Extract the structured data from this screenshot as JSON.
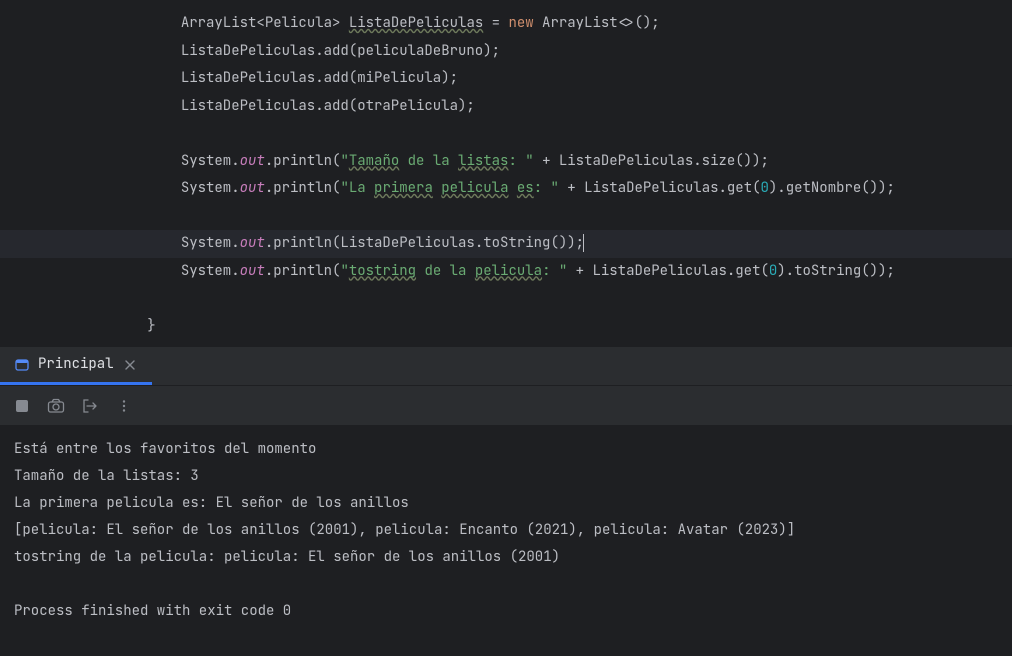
{
  "code": {
    "lines": [
      {
        "indent": 3,
        "segments": [
          {
            "text": "ArrayList",
            "cls": "type"
          },
          {
            "text": "<",
            "cls": ""
          },
          {
            "text": "Pelicula",
            "cls": "type"
          },
          {
            "text": "> ",
            "cls": ""
          },
          {
            "text": "ListaDePeliculas",
            "cls": "warn"
          },
          {
            "text": " = ",
            "cls": ""
          },
          {
            "text": "new",
            "cls": "kw"
          },
          {
            "text": " ArrayList<>();",
            "cls": ""
          }
        ]
      },
      {
        "indent": 3,
        "segments": [
          {
            "text": "ListaDePeliculas.add(peliculaDeBruno);",
            "cls": ""
          }
        ]
      },
      {
        "indent": 3,
        "segments": [
          {
            "text": "ListaDePeliculas.add(miPelicula);",
            "cls": ""
          }
        ]
      },
      {
        "indent": 3,
        "segments": [
          {
            "text": "ListaDePeliculas.add(otraPelicula);",
            "cls": ""
          }
        ]
      },
      {
        "indent": 0,
        "segments": []
      },
      {
        "indent": 3,
        "segments": [
          {
            "text": "System.",
            "cls": ""
          },
          {
            "text": "out",
            "cls": "static-field"
          },
          {
            "text": ".println(",
            "cls": ""
          },
          {
            "text": "\"",
            "cls": "string"
          },
          {
            "text": "Tamaño",
            "cls": "string warn"
          },
          {
            "text": " de la ",
            "cls": "string"
          },
          {
            "text": "listas",
            "cls": "string warn"
          },
          {
            "text": ": \"",
            "cls": "string"
          },
          {
            "text": " + ListaDePeliculas.size());",
            "cls": ""
          }
        ]
      },
      {
        "indent": 3,
        "segments": [
          {
            "text": "System.",
            "cls": ""
          },
          {
            "text": "out",
            "cls": "static-field"
          },
          {
            "text": ".println(",
            "cls": ""
          },
          {
            "text": "\"La ",
            "cls": "string"
          },
          {
            "text": "primera",
            "cls": "string warn"
          },
          {
            "text": " ",
            "cls": "string"
          },
          {
            "text": "pelicula",
            "cls": "string warn"
          },
          {
            "text": " ",
            "cls": "string"
          },
          {
            "text": "es",
            "cls": "string warn"
          },
          {
            "text": ": \"",
            "cls": "string"
          },
          {
            "text": " + ListaDePeliculas.get(",
            "cls": ""
          },
          {
            "text": "0",
            "cls": "number"
          },
          {
            "text": ").getNombre());",
            "cls": ""
          }
        ]
      },
      {
        "indent": 0,
        "segments": []
      },
      {
        "indent": 3,
        "highlighted": true,
        "segments": [
          {
            "text": "System.",
            "cls": ""
          },
          {
            "text": "out",
            "cls": "static-field"
          },
          {
            "text": ".println(ListaDePeliculas.",
            "cls": ""
          },
          {
            "text": "toString",
            "cls": "method"
          },
          {
            "text": "());",
            "cls": ""
          }
        ],
        "caret": true
      },
      {
        "indent": 3,
        "segments": [
          {
            "text": "System.",
            "cls": ""
          },
          {
            "text": "out",
            "cls": "static-field"
          },
          {
            "text": ".println(",
            "cls": ""
          },
          {
            "text": "\"",
            "cls": "string"
          },
          {
            "text": "tostring",
            "cls": "string warn"
          },
          {
            "text": " de la ",
            "cls": "string"
          },
          {
            "text": "pelicula",
            "cls": "string warn"
          },
          {
            "text": ": \"",
            "cls": "string"
          },
          {
            "text": " + ListaDePeliculas.get(",
            "cls": ""
          },
          {
            "text": "0",
            "cls": "number"
          },
          {
            "text": ").toString());",
            "cls": ""
          }
        ]
      },
      {
        "indent": 0,
        "segments": []
      },
      {
        "indent": 2,
        "segments": [
          {
            "text": "}",
            "cls": ""
          }
        ]
      }
    ]
  },
  "tab": {
    "label": "Principal"
  },
  "console": {
    "lines": [
      "Está entre los favoritos del momento",
      "Tamaño de la listas: 3",
      "La primera pelicula es: El señor de los anillos",
      "[pelicula: El señor de los anillos (2001), pelicula: Encanto (2021), pelicula: Avatar (2023)]",
      "tostring de la pelicula: pelicula: El señor de los anillos (2001)",
      "",
      "Process finished with exit code 0"
    ]
  }
}
